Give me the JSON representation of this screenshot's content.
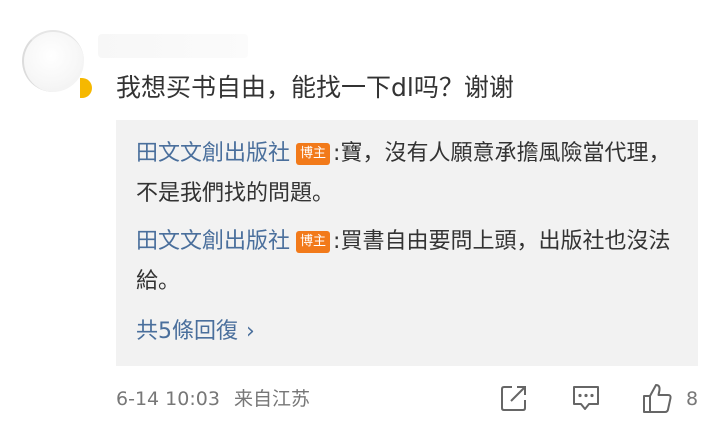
{
  "comment": {
    "text": "我想买书自由，能找一下dl吗？谢谢"
  },
  "replies": [
    {
      "author": "田文文創出版社",
      "badge": "博主",
      "separator": ":",
      "text": "寶，沒有人願意承擔風險當代理，不是我們找的問題。"
    },
    {
      "author": "田文文創出版社",
      "badge": "博主",
      "separator": ":",
      "text": "買書自由要問上頭，出版社也沒法給。"
    }
  ],
  "more_replies": {
    "label": "共5條回復",
    "chevron": "›"
  },
  "meta": {
    "datetime": "6-14 10:03",
    "location": "来自江苏"
  },
  "actions": {
    "like_count": "8",
    "icons": [
      "share-icon",
      "comment-icon",
      "thumbs-up-icon"
    ]
  },
  "colors": {
    "link": "#4a6f9c",
    "badge": "#f27a1a",
    "reply_bg": "#f2f2f2",
    "meta": "#777777"
  }
}
